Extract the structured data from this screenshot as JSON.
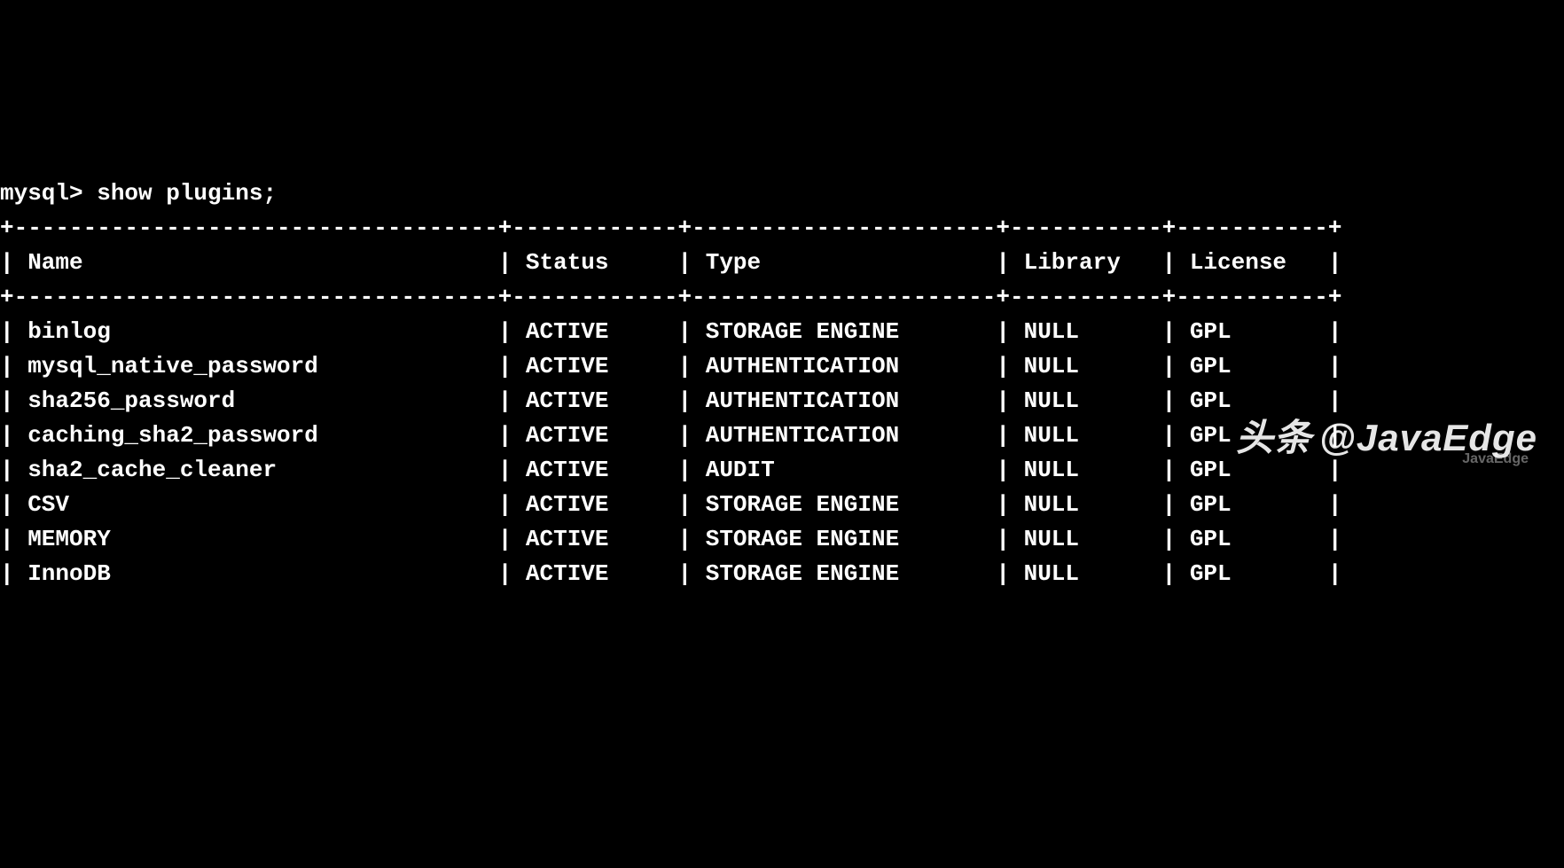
{
  "prompt": "mysql> ",
  "command": "show plugins;",
  "columns": {
    "name": "Name",
    "status": "Status",
    "type": "Type",
    "library": "Library",
    "license": "License"
  },
  "rows": [
    {
      "name": "binlog",
      "status": "ACTIVE",
      "type": "STORAGE ENGINE",
      "library": "NULL",
      "license": "GPL"
    },
    {
      "name": "mysql_native_password",
      "status": "ACTIVE",
      "type": "AUTHENTICATION",
      "library": "NULL",
      "license": "GPL"
    },
    {
      "name": "sha256_password",
      "status": "ACTIVE",
      "type": "AUTHENTICATION",
      "library": "NULL",
      "license": "GPL"
    },
    {
      "name": "caching_sha2_password",
      "status": "ACTIVE",
      "type": "AUTHENTICATION",
      "library": "NULL",
      "license": "GPL"
    },
    {
      "name": "sha2_cache_cleaner",
      "status": "ACTIVE",
      "type": "AUDIT",
      "library": "NULL",
      "license": "GPL"
    },
    {
      "name": "CSV",
      "status": "ACTIVE",
      "type": "STORAGE ENGINE",
      "library": "NULL",
      "license": "GPL"
    },
    {
      "name": "MEMORY",
      "status": "ACTIVE",
      "type": "STORAGE ENGINE",
      "library": "NULL",
      "license": "GPL"
    },
    {
      "name": "InnoDB",
      "status": "ACTIVE",
      "type": "STORAGE ENGINE",
      "library": "NULL",
      "license": "GPL"
    }
  ],
  "widths": {
    "name": 33,
    "status": 10,
    "type": 20,
    "library": 9,
    "license": 9
  },
  "watermark": {
    "prefix": "头条",
    "handle": "@JavaEdge",
    "small": "JavaEdge"
  }
}
